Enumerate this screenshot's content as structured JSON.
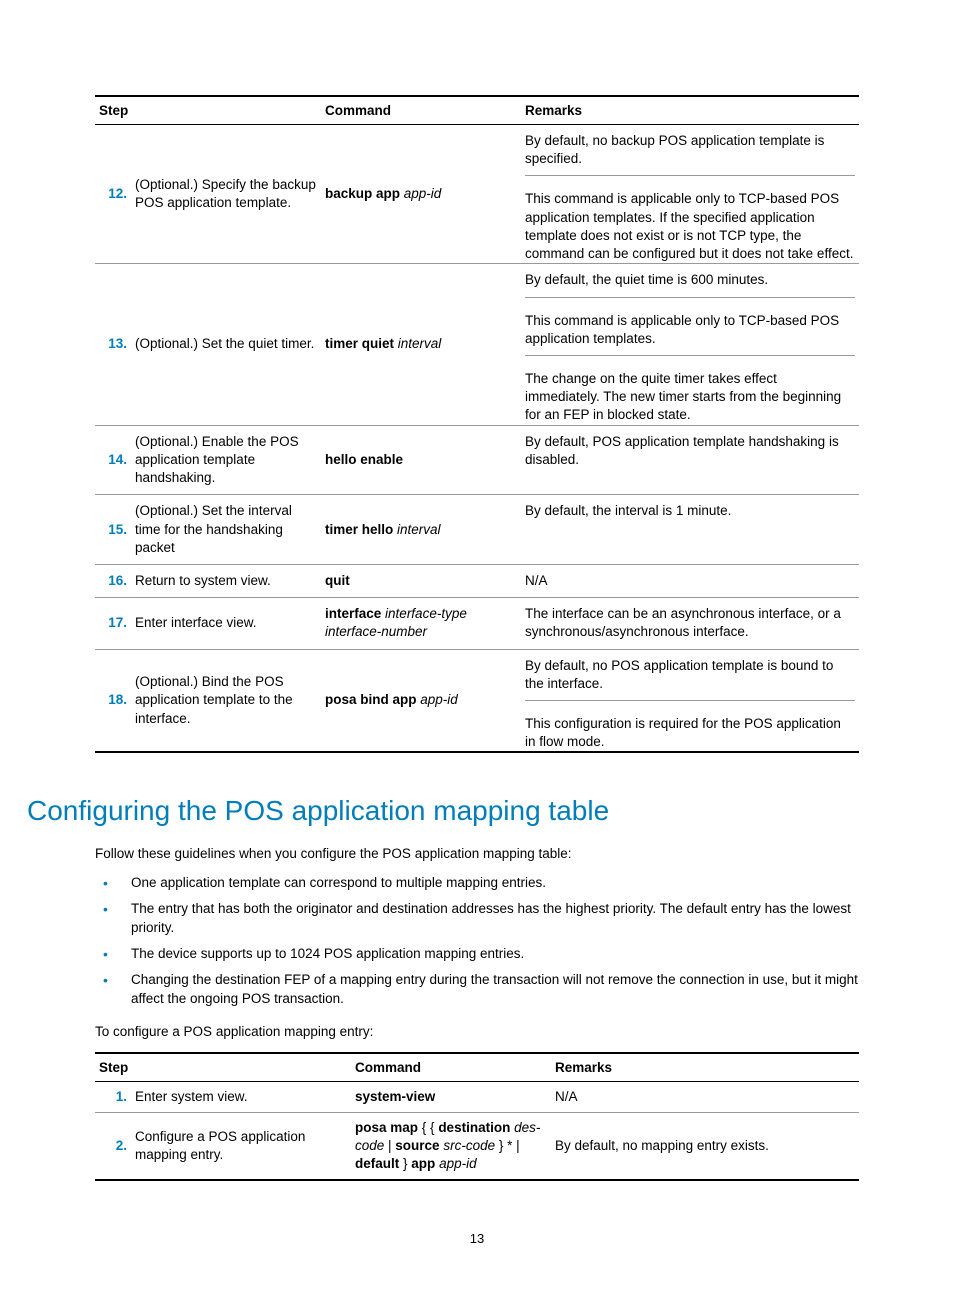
{
  "table1": {
    "headers": {
      "step": "Step",
      "command": "Command",
      "remarks": "Remarks"
    },
    "rows": [
      {
        "num": "12.",
        "step": "(Optional.) Specify the backup POS application template.",
        "command_html": "<span class='b'>backup app</span> <span class='i'>app-id</span>",
        "remarks": [
          "By default, no backup POS application template is specified.",
          "This command is applicable only to TCP-based POS application templates. If the specified application template does not exist or is not TCP type, the command can be configured but it does not take effect."
        ]
      },
      {
        "num": "13.",
        "step": "(Optional.) Set the quiet timer.",
        "command_html": "<span class='b'>timer quiet</span> <span class='i'>interval</span>",
        "remarks": [
          "By default, the quiet time is 600 minutes.",
          "This command is applicable only to TCP-based POS application templates.",
          "The change on the quite timer takes effect immediately. The new timer starts from the beginning for an FEP in blocked state."
        ]
      },
      {
        "num": "14.",
        "step": "(Optional.) Enable the POS application template handshaking.",
        "command_html": "<span class='b'>hello enable</span>",
        "remarks": [
          "By default, POS application template handshaking is disabled."
        ]
      },
      {
        "num": "15.",
        "step": "(Optional.) Set the interval time for the handshaking packet",
        "command_html": "<span class='b'>timer hello</span> <span class='i'>interval</span>",
        "remarks": [
          "By default, the interval is 1 minute."
        ]
      },
      {
        "num": "16.",
        "step": "Return to system view.",
        "command_html": "<span class='b'>quit</span>",
        "remarks": [
          "N/A"
        ]
      },
      {
        "num": "17.",
        "step": "Enter interface view.",
        "command_html": "<span class='b'>interface</span> <span class='i'>interface-type interface-number</span>",
        "remarks": [
          "The interface can be an asynchronous interface, or a synchronous/asynchronous interface."
        ]
      },
      {
        "num": "18.",
        "step": "(Optional.) Bind the POS application template to the interface.",
        "command_html": "<span class='b'>posa bind app</span> <span class='i'>app-id</span>",
        "remarks": [
          "By default, no POS application template is bound to the interface.",
          "This configuration is required for the POS application in flow mode."
        ]
      }
    ]
  },
  "section": {
    "heading": "Configuring the POS application mapping table",
    "intro": "Follow these guidelines when you configure the POS application mapping table:",
    "bullets": [
      "One application template can correspond to multiple mapping entries.",
      "The entry that has both the originator and destination addresses has the highest priority. The default entry has the lowest priority.",
      "The device supports up to 1024 POS application mapping entries.",
      "Changing the destination FEP of a mapping entry during the transaction will not remove the connection in use, but it might affect the ongoing POS transaction."
    ],
    "lead": "To configure a POS application mapping entry:"
  },
  "table2": {
    "headers": {
      "step": "Step",
      "command": "Command",
      "remarks": "Remarks"
    },
    "rows": [
      {
        "num": "1.",
        "step": "Enter system view.",
        "command_html": "<span class='b'>system-view</span>",
        "remarks": "N/A"
      },
      {
        "num": "2.",
        "step": "Configure a POS application mapping entry.",
        "command_html": "<span class='b'>posa map</span> { { <span class='b'>destination</span> <span class='i'>des-code</span> | <span class='b'>source</span> <span class='i'>src-code</span> } * | <span class='b'>default</span> } <span class='b'>app</span> <span class='i'>app-id</span>",
        "remarks": "By default, no mapping entry exists."
      }
    ]
  },
  "pagenum": "13"
}
